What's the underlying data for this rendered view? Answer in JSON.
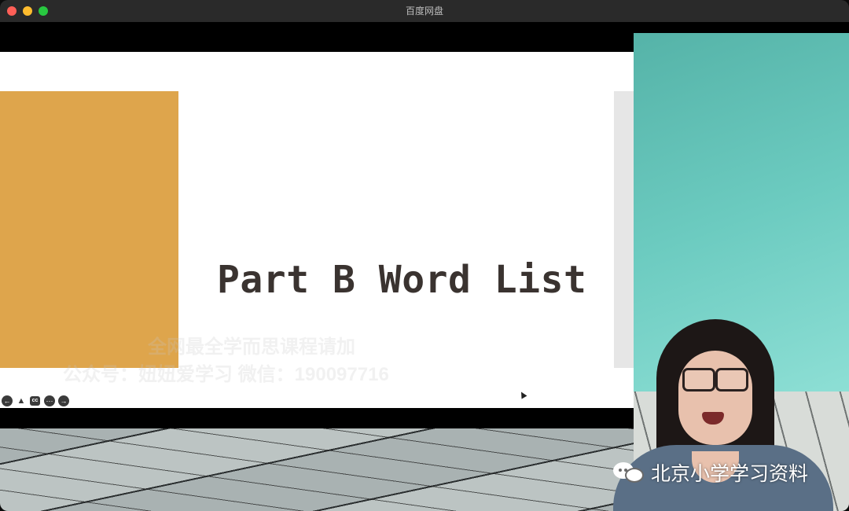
{
  "window": {
    "title": "百度网盘"
  },
  "slide": {
    "title": "Part B Word List",
    "watermark_line1": "全网最全学而思课程请加",
    "watermark_line2": "公众号：妞妞爱学习  微信：190097716"
  },
  "player_controls": {
    "back_icon": "arrow-left-icon",
    "person_icon": "user-icon",
    "cc_label": "cc",
    "more_icon": "more-icon",
    "forward_icon": "arrow-right-icon"
  },
  "overlay": {
    "brand_text": "北京小学学习资料"
  },
  "colors": {
    "orange_block": "#dea54c",
    "teal_wall": "#6ccbc0",
    "slide_text": "#3a3330"
  }
}
